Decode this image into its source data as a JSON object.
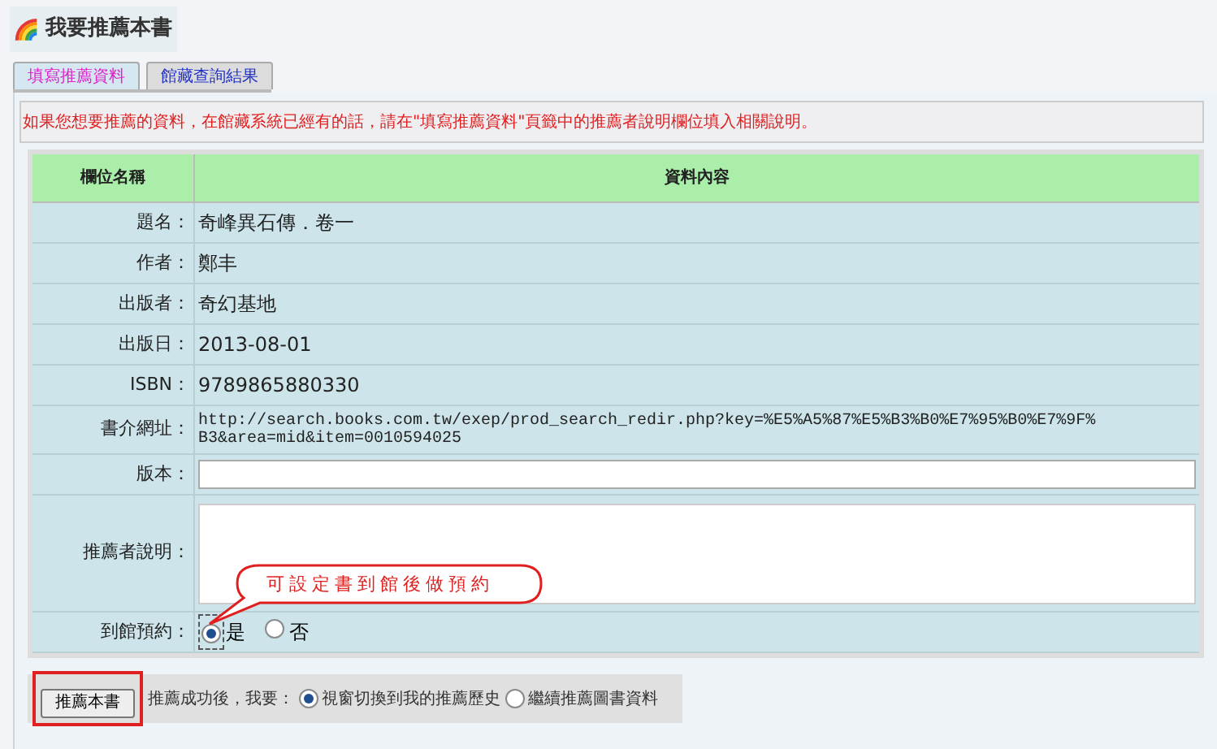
{
  "header": {
    "title": "我要推薦本書"
  },
  "tabs": [
    {
      "label": "填寫推薦資料",
      "selected": true
    },
    {
      "label": "館藏查詢結果",
      "selected": false
    }
  ],
  "notice": "如果您想要推薦的資料，在館藏系統已經有的話，請在\"填寫推薦資料\"頁籤中的推薦者說明欄位填入相關說明。",
  "table": {
    "columns": [
      "欄位名稱",
      "資料內容"
    ],
    "rows": [
      {
        "kind": "text",
        "label": "題名：",
        "value": "奇峰異石傳．卷一"
      },
      {
        "kind": "text",
        "label": "作者：",
        "value": "鄭丰"
      },
      {
        "kind": "text",
        "label": "出版者：",
        "value": "奇幻基地"
      },
      {
        "kind": "text",
        "label": "出版日：",
        "value": "2013-08-01"
      },
      {
        "kind": "text",
        "label": "ISBN：",
        "value": "9789865880330"
      },
      {
        "kind": "url",
        "label": "書介網址：",
        "value": "http://search.books.com.tw/exep/prod_search_redir.php?key=%E5%A5%87%E5%B3%B0%E7%95%B0%E7%9F%B3&area=mid&item=0010594025"
      },
      {
        "kind": "input",
        "label": "版本："
      },
      {
        "kind": "textarea",
        "label": "推薦者說明："
      },
      {
        "kind": "radio",
        "label": "到館預約：",
        "options": [
          {
            "label": "是",
            "selected": true
          },
          {
            "label": "否",
            "selected": false
          }
        ]
      }
    ]
  },
  "callout": "可設定書到館後做預約",
  "footer": {
    "button": "推薦本書",
    "prompt": "推薦成功後，我要：",
    "options": [
      {
        "label": "視窗切換到我的推薦歷史",
        "selected": true
      },
      {
        "label": "繼續推薦圖書資料",
        "selected": false
      }
    ]
  }
}
